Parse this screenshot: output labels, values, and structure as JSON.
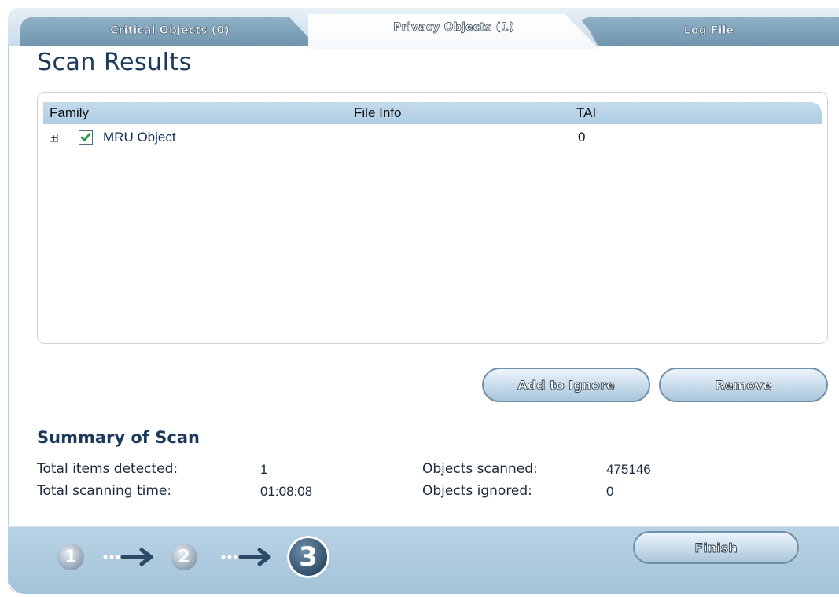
{
  "tabs": [
    {
      "label": "Critical Objects (0)"
    },
    {
      "label": "Privacy Objects (1)"
    },
    {
      "label": "Log File"
    }
  ],
  "page_title": "Scan Results",
  "results": {
    "columns": [
      "Family",
      "File Info",
      "TAI"
    ],
    "rows": [
      {
        "family": "MRU Object",
        "file_info": "",
        "tai": "0",
        "checked": true,
        "expand": "+"
      }
    ]
  },
  "buttons": {
    "add_to_ignore": "Add to Ignore",
    "remove": "Remove",
    "finish": "Finish"
  },
  "summary": {
    "title": "Summary of Scan",
    "total_items_label": "Total items detected:",
    "total_items_value": "1",
    "total_time_label": "Total scanning time:",
    "total_time_value": "01:08:08",
    "objects_scanned_label": "Objects scanned:",
    "objects_scanned_value": "475146",
    "objects_ignored_label": "Objects ignored:",
    "objects_ignored_value": "0"
  },
  "steps": [
    "1",
    "2",
    "3"
  ],
  "colors": {
    "accent": "#1d3a5a",
    "header_blue": "#aecde3",
    "checkbox_green": "#1f9b3a"
  }
}
